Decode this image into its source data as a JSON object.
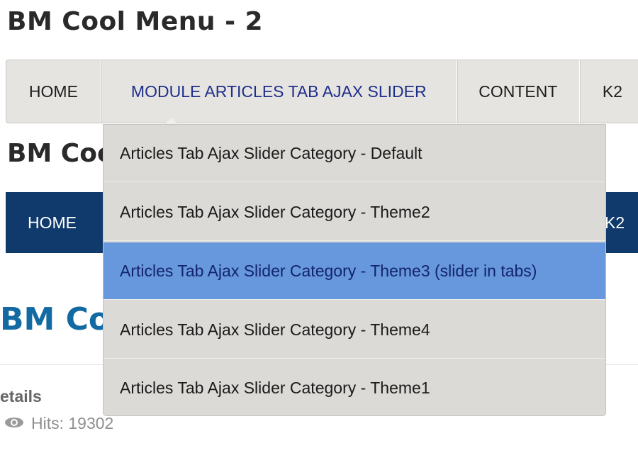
{
  "titles": {
    "menu1": "BM Cool Menu - 2",
    "menu2_partial": "BM Coo",
    "menu3_partial": "BM Co"
  },
  "menubar1": {
    "items": [
      {
        "label": "HOME"
      },
      {
        "label": "MODULE ARTICLES TAB AJAX SLIDER"
      },
      {
        "label": "CONTENT"
      },
      {
        "label": "K2"
      }
    ]
  },
  "menubar2": {
    "items": [
      {
        "label": "HOME"
      },
      {
        "label": "K2"
      }
    ]
  },
  "dropdown": {
    "items": [
      {
        "label": "Articles Tab Ajax Slider Category - Default"
      },
      {
        "label": "Articles Tab Ajax Slider Category - Theme2"
      },
      {
        "label": "Articles Tab Ajax Slider Category - Theme3 (slider in tabs)"
      },
      {
        "label": "Articles Tab Ajax Slider Category - Theme4"
      },
      {
        "label": "Articles Tab Ajax Slider Category - Theme1"
      }
    ]
  },
  "article": {
    "details_label": "etails",
    "hits_label": "Hits: 19302"
  },
  "colors": {
    "menubar1_bg": "#e6e4e1",
    "menubar2_bg": "#0f3a6b",
    "dropdown_bg": "#dcdad6",
    "selected_bg": "#6797dc",
    "title3_color": "#136aa3"
  },
  "icons": {
    "hits_icon": "eye-icon"
  }
}
